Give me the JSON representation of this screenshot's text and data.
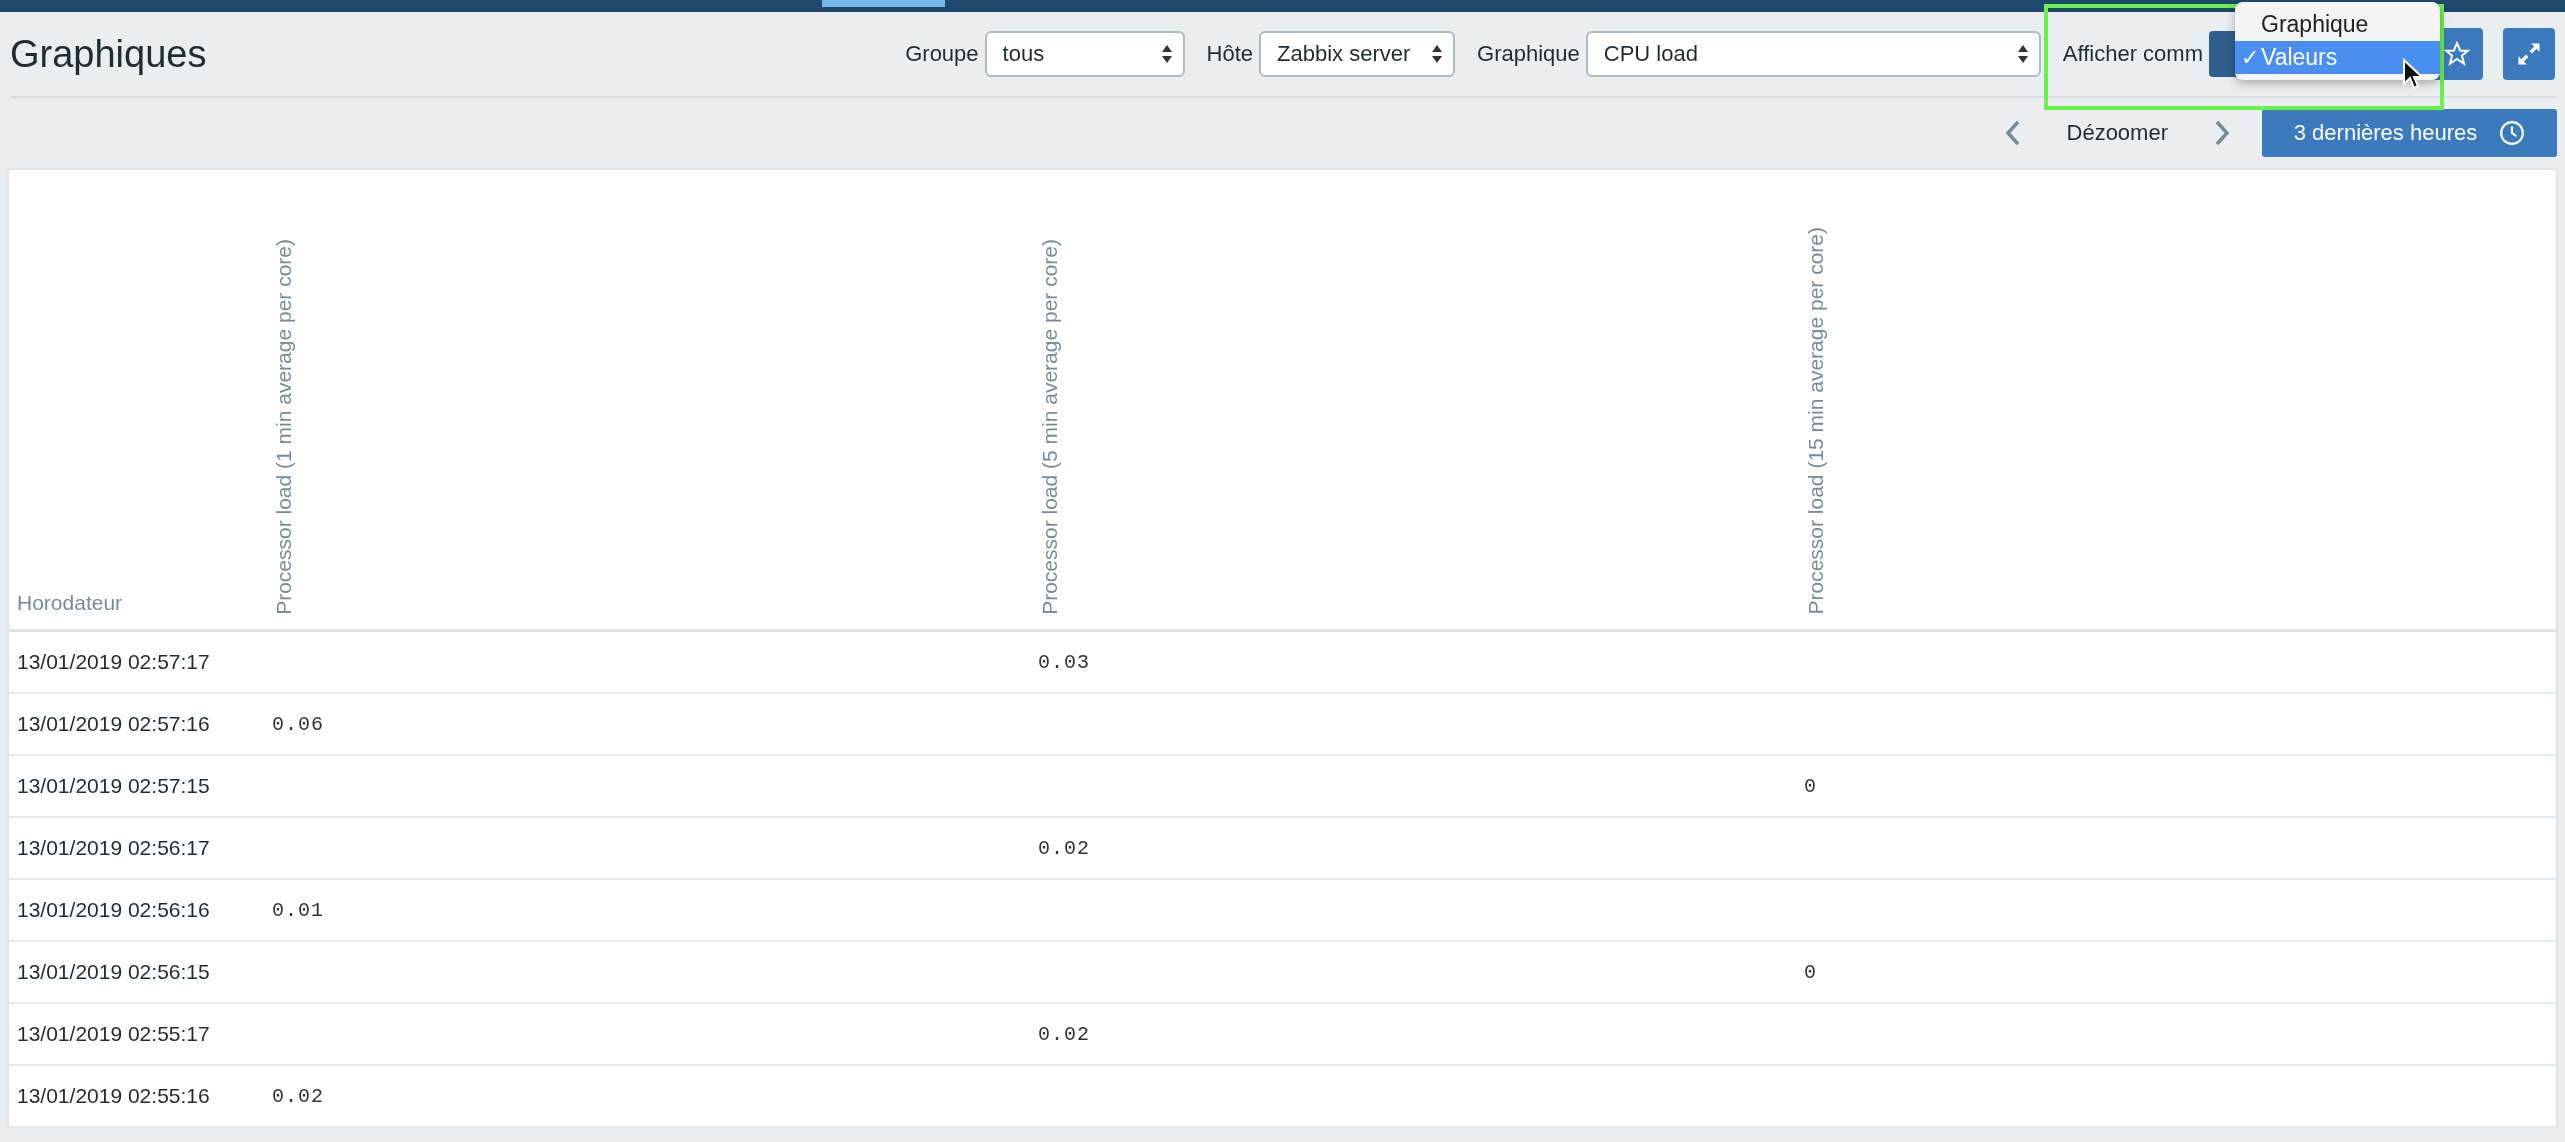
{
  "page": {
    "title": "Graphiques"
  },
  "filters": [
    {
      "kind": "select",
      "label": "Groupe",
      "value": "tous"
    },
    {
      "kind": "select",
      "label": "Hôte",
      "value": "Zabbix server"
    },
    {
      "kind": "select",
      "label": "Graphique",
      "value": "CPU load"
    },
    {
      "kind": "menu",
      "label": "Afficher comm"
    }
  ],
  "view_menu": {
    "check": "✓",
    "options": [
      {
        "label": "Graphique",
        "selected": false
      },
      {
        "label": "Valeurs",
        "selected": true
      }
    ]
  },
  "time_nav": {
    "zoom_out": "Dézoomer",
    "period_button": "3 dernières heures"
  },
  "table": {
    "columns": [
      "Horodateur",
      "Processor load (1 min average per core)",
      "Processor load (5 min average per core)",
      "Processor load (15 min average per core)"
    ],
    "rows": [
      {
        "time": "13/01/2019 02:57:17",
        "load_5min": "0.03"
      },
      {
        "time": "13/01/2019 02:57:16",
        "load_1min": "0.06"
      },
      {
        "time": "13/01/2019 02:57:15",
        "load_15min": "0"
      },
      {
        "time": "13/01/2019 02:56:17",
        "load_5min": "0.02"
      },
      {
        "time": "13/01/2019 02:56:16",
        "load_1min": "0.01"
      },
      {
        "time": "13/01/2019 02:56:15",
        "load_15min": "0"
      },
      {
        "time": "13/01/2019 02:55:17",
        "load_5min": "0.02"
      },
      {
        "time": "13/01/2019 02:55:16",
        "load_1min": "0.02"
      }
    ]
  }
}
